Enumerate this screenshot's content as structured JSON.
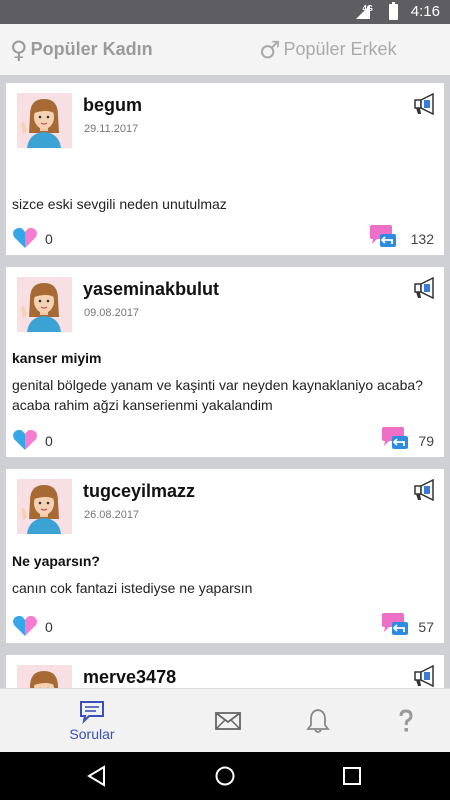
{
  "status_bar": {
    "time": "4:16",
    "network": "4G"
  },
  "top_tabs": [
    {
      "label": "Popüler Kadın",
      "symbol": "♀"
    },
    {
      "label": "Popüler Erkek",
      "symbol": "♂"
    }
  ],
  "posts": [
    {
      "username": "begum",
      "date": "29.11.2017",
      "title": "",
      "body": "sizce eski sevgili neden unutulmaz",
      "likes": "0",
      "comments": "132"
    },
    {
      "username": "yaseminakbulut",
      "date": "09.08.2017",
      "title": "kanser miyim",
      "body": "genital bölgede yanam ve kaşinti var neyden kaynaklaniyo acaba? acaba rahim ağzi kanserienmi yakalandim",
      "likes": "0",
      "comments": "79"
    },
    {
      "username": "tugceyilmazz",
      "date": "26.08.2017",
      "title": "Ne yaparsın?",
      "body": "canın cok fantazi istediyse ne yaparsın",
      "likes": "0",
      "comments": "57"
    },
    {
      "username": "merve3478",
      "date": "",
      "title": "",
      "body": "",
      "likes": "",
      "comments": ""
    }
  ],
  "bottom_nav": {
    "questions_label": "Sorular",
    "items": [
      "questions-icon",
      "mail-icon",
      "bell-icon",
      "help-icon"
    ]
  },
  "colors": {
    "accent": "#3b4fb8",
    "like_pink": "#f77bd0",
    "like_blue": "#36a7e6",
    "comment_pink": "#ee6fc6"
  }
}
